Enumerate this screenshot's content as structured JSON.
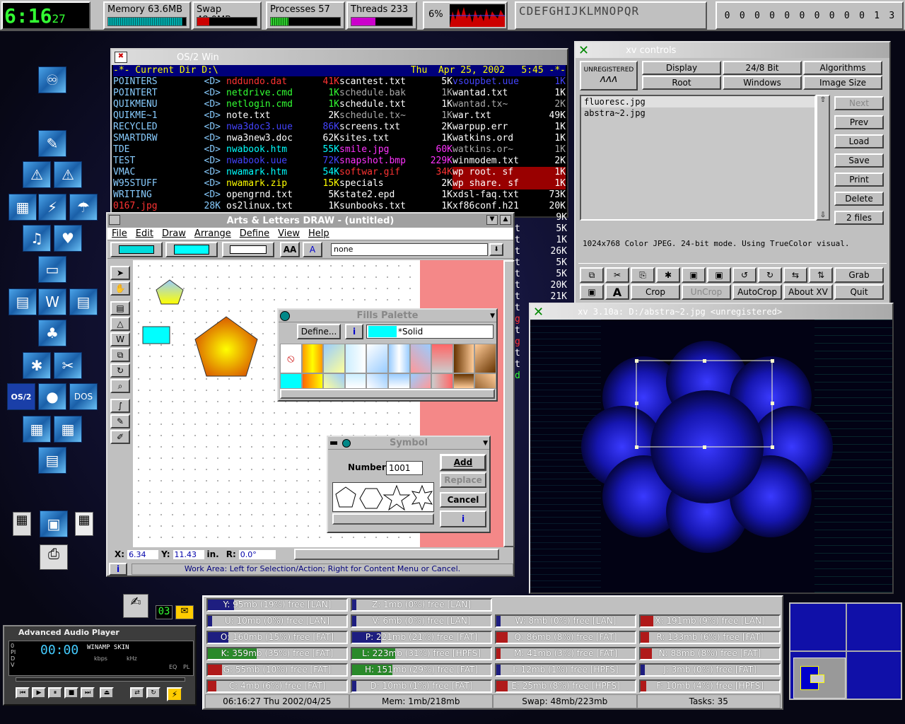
{
  "topbar": {
    "clock": "6:16",
    "seconds": "27",
    "memory": "Memory 63.6MB",
    "swap": "Swap 48.0MB",
    "processes": "Processes 57",
    "threads": "Threads 233",
    "cpu": "6%",
    "drives": "CDEFGHIJKLMNOPQR",
    "counter": [
      "0",
      "0",
      "0",
      "0",
      "0",
      "0",
      "0",
      "0",
      "0",
      "0",
      "1",
      "3"
    ],
    "memory_fill": 0.95,
    "swap_fill": 0.2,
    "processes_fill": 0.5,
    "threads_fill": 0.4
  },
  "os2win": {
    "title": "OS/2 Win",
    "header_left": "-*- Current Dir D:\\",
    "header_date": "Thu  Apr 25, 2002   5:45 -*-",
    "col1": [
      [
        "POINTERS",
        "<D>"
      ],
      [
        "POINTERT",
        "<D>"
      ],
      [
        "QUIKMENU",
        "<D>"
      ],
      [
        "QUIKME~1",
        "<D>"
      ],
      [
        "RECYCLED",
        "<D>"
      ],
      [
        "SMARTDRW",
        "<D>"
      ],
      [
        "TDE",
        "<D>"
      ],
      [
        "TEST",
        "<D>"
      ],
      [
        "VMAC",
        "<D>"
      ],
      [
        "W95STUFF",
        "<D>"
      ],
      [
        "WRITING",
        "<D>"
      ],
      [
        "0167.jpg",
        "28K"
      ]
    ],
    "col2": [
      [
        "nddundo.dat",
        "41K"
      ],
      [
        "netdrive.cmd",
        "1K"
      ],
      [
        "netlogin.cmd",
        "1K"
      ],
      [
        "note.txt",
        "2K"
      ],
      [
        "nwa3doc3.uue",
        "86K"
      ],
      [
        "nwa3new3.doc",
        "62K"
      ],
      [
        "nwabook.htm",
        "55K"
      ],
      [
        "nwabook.uue",
        "72K"
      ],
      [
        "nwamark.htm",
        "54K"
      ],
      [
        "nwamark.zip",
        "15K"
      ],
      [
        "opengrnd.txt",
        "5K"
      ],
      [
        "os2linux.txt",
        "1K"
      ]
    ],
    "col3": [
      [
        "scantest.txt",
        "5K"
      ],
      [
        "schedule.bak",
        "1K"
      ],
      [
        "schedule.txt",
        "1K"
      ],
      [
        "schedule.tx~",
        "1K"
      ],
      [
        "screens.txt",
        "2K"
      ],
      [
        "sites.txt",
        "1K"
      ],
      [
        "smile.jpg",
        "60K"
      ],
      [
        "snapshot.bmp",
        "229K"
      ],
      [
        "softwar.gif",
        "34K"
      ],
      [
        "specials",
        "2K"
      ],
      [
        "state2.epd",
        "1K"
      ],
      [
        "sunbooks.txt",
        "1K"
      ]
    ],
    "col4": [
      [
        "vsoupbet.uue",
        "1K"
      ],
      [
        "wantad.txt",
        "1K"
      ],
      [
        "wantad.tx~",
        "2K"
      ],
      [
        "war.txt",
        "49K"
      ],
      [
        "warpup.err",
        "1K"
      ],
      [
        "watkins.ord",
        "1K"
      ],
      [
        "watkins.or~",
        "1K"
      ],
      [
        "winmodem.txt",
        "2K"
      ],
      [
        "wp root. sf",
        "1K"
      ],
      [
        "wp share. sf",
        "1K"
      ],
      [
        "xdsl-faq.txt",
        "73K"
      ],
      [
        "xf86conf.h21",
        "20K"
      ]
    ],
    "extra_sizes": [
      "9K",
      "5K",
      "1K",
      "26K",
      "5K",
      "5K",
      "20K",
      "21K"
    ],
    "extra_t": [
      "t",
      "t",
      "t",
      "t",
      "t",
      "t",
      "t",
      "t",
      "g",
      "t",
      "g",
      "t",
      "t",
      "d"
    ]
  },
  "aldraw": {
    "title": "Arts & Letters DRAW - (untitled)",
    "menu": [
      "File",
      "Edit",
      "Draw",
      "Arrange",
      "Define",
      "View",
      "Help"
    ],
    "fill_name": "none",
    "aa": "AA",
    "x_label": "X:",
    "x_val": "6.34",
    "y_label": "Y:",
    "y_val": "11.43",
    "unit": "in.",
    "r_label": "R:",
    "r_val": "0.0°",
    "status": "Work Area: Left for Selection/Action; Right for Content Menu or Cancel.",
    "tools": [
      "W"
    ]
  },
  "fills": {
    "title": "Fills Palette",
    "define": "Define...",
    "info": "i",
    "solid": "*Solid"
  },
  "symbol": {
    "title": "Symbol",
    "number_label": "Number:",
    "number": "1001",
    "add": "Add",
    "replace": "Replace",
    "cancel": "Cancel",
    "info": "i"
  },
  "xvctl": {
    "title": "xv controls",
    "unreg": "UNREGISTERED",
    "buttons1": [
      "Display",
      "24/8 Bit",
      "Algorithms"
    ],
    "buttons2": [
      "Root",
      "Windows",
      "Image Size"
    ],
    "files": [
      "fluoresc.jpg",
      "abstra~2.jpg"
    ],
    "side": [
      "Next",
      "Prev",
      "Load",
      "Save",
      "Print",
      "Delete",
      "2 files"
    ],
    "info": "1024x768 Color  JPEG.  24-bit mode.  Using TrueColor visual.",
    "row2": [
      "Crop",
      "UnCrop",
      "AutoCrop",
      "About XV",
      "Quit"
    ],
    "grab": "Grab"
  },
  "xvimg": {
    "title": "xv 3.10a: D:/abstra~2.jpg <unregistered>"
  },
  "audio": {
    "title": "Advanced Audio Player",
    "time": "00:00",
    "skin": "WINAMP SKIN",
    "kbps": "kbps",
    "khz": "kHz",
    "eq": "EQ",
    "pl": "PL",
    "side": "0PIDV"
  },
  "mini": {
    "day": "03"
  },
  "drives": [
    [
      {
        "t": "Y: 95mb (19%) free [LAN]",
        "p": 0.19
      },
      {
        "t": "Z: 1mb (0%) free [LAN]",
        "p": 0
      }
    ],
    [
      {
        "t": "U: 10mb (0%) free [LAN]",
        "p": 0
      },
      {
        "t": "V: 6mb (0%) free [LAN]",
        "p": 0
      },
      {
        "t": "W: 8mb (0%) free [LAN]",
        "p": 0
      },
      {
        "t": "X: 191mb (9%) free [LAN]",
        "p": 0.09
      }
    ],
    [
      {
        "t": "O: 160mb (15%) free [FAT]",
        "p": 0.15
      },
      {
        "t": "P: 221mb (21%) free [FAT]",
        "p": 0.21
      },
      {
        "t": "Q: 86mb (8%) free [FAT]",
        "p": 0.08
      },
      {
        "t": "R: 133mb (6%) free [FAT]",
        "p": 0.06
      }
    ],
    [
      {
        "t": "K: 359mb (35%) free [FAT]",
        "p": 0.35
      },
      {
        "t": "L: 223mb (31%) free [HPFS]",
        "p": 0.31
      },
      {
        "t": "M: 41mb (3%) free [FAT]",
        "p": 0.03
      },
      {
        "t": "N: 88mb (8%) free [FAT]",
        "p": 0.08
      }
    ],
    [
      {
        "t": "G: 55mb (10%) free [FAT]",
        "p": 0.1
      },
      {
        "t": "H: 151mb (29%) free [FAT]",
        "p": 0.29
      },
      {
        "t": "I: 12mb (1%) free [HPFS]",
        "p": 0.01
      },
      {
        "t": "J: 3mb (0%) free [FAT]",
        "p": 0
      }
    ],
    [
      {
        "t": "C: 4mb (6%) free [FAT]",
        "p": 0.06
      },
      {
        "t": "D: 10mb (1%) free [FAT]",
        "p": 0.01
      },
      {
        "t": "E: 25mb (8%) free [HPFS]",
        "p": 0.08
      },
      {
        "t": "F: 10mb (4%) free [HPFS]",
        "p": 0.04
      }
    ]
  ],
  "statusbar": [
    "06:16:27  Thu 2002/04/25",
    "Mem: 1mb/218mb",
    "Swap: 48mb/223mb",
    "Tasks: 35"
  ],
  "desktop_icons": [
    "OS/2",
    "DOS"
  ]
}
